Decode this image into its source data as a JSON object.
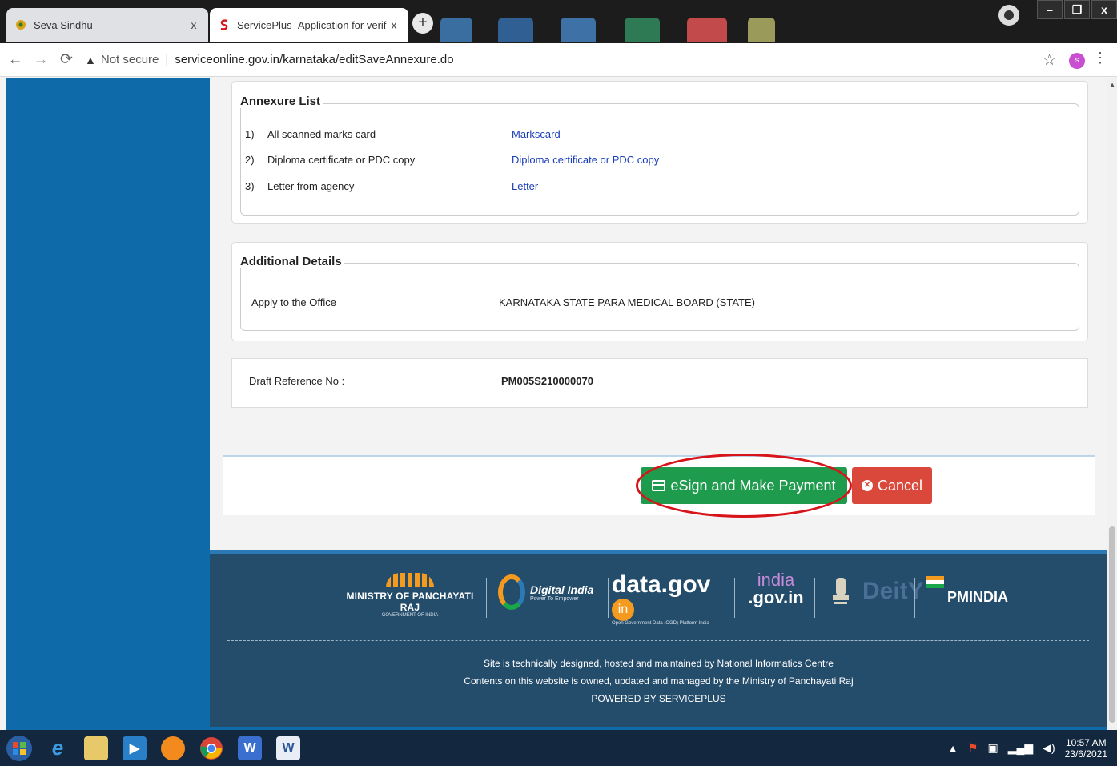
{
  "browser": {
    "tabs": [
      {
        "title": "Seva Sindhu",
        "favicon": "seva-sindhu-icon"
      },
      {
        "title": "ServicePlus- Application for verif",
        "favicon": "serviceplus-icon"
      }
    ],
    "new_tab": "+",
    "close_glyph": "x",
    "window_controls": {
      "minimize": "–",
      "maximize": "❐",
      "close": "x"
    },
    "address": {
      "security_label": "Not secure",
      "url": "serviceonline.gov.in/karnataka/editSaveAnnexure.do"
    },
    "avatar_letter": "s"
  },
  "annexure": {
    "legend": "Annexure List",
    "items": [
      {
        "num": "1)",
        "label": "All scanned marks card",
        "link": "Markscard"
      },
      {
        "num": "2)",
        "label": "Diploma certificate or PDC copy",
        "link": "Diploma certificate or PDC copy"
      },
      {
        "num": "3)",
        "label": "Letter from agency",
        "link": "Letter"
      }
    ]
  },
  "additional": {
    "legend": "Additional Details",
    "label": "Apply to the Office",
    "value": "KARNATAKA STATE PARA MEDICAL BOARD (STATE)"
  },
  "draft": {
    "label": "Draft Reference No :",
    "value": "PM005S210000070"
  },
  "actions": {
    "esign_label": "eSign and Make Payment",
    "cancel_label": "Cancel"
  },
  "footer": {
    "logos": {
      "mopr_title": "MINISTRY OF PANCHAYATI RAJ",
      "mopr_sub": "GOVERNMENT OF INDIA",
      "digital_india": "Digital India",
      "digital_india_sub": "Power To Empower",
      "datagov": "data.gov",
      "datagov_badge": "in",
      "datagov_sub": "Open Government Data (OGD) Platform India",
      "india_top": "india",
      "india_bottom": ".gov.in",
      "dey": "DeitY",
      "pmindia": "PMINDIA"
    },
    "line1": "Site is technically designed, hosted and maintained by National Informatics Centre",
    "line2": "Contents on this website is owned, updated and managed by the Ministry of Panchayati Raj",
    "line3": "POWERED BY SERVICEPLUS"
  },
  "taskbar": {
    "time": "10:57 AM",
    "date": "23/6/2021"
  },
  "colors": {
    "sidebar": "#0e6aa8",
    "esign_button": "#1f9b4e",
    "cancel_button": "#d9483b",
    "footer": "#244c6b",
    "highlight_ellipse": "#d8141b"
  }
}
